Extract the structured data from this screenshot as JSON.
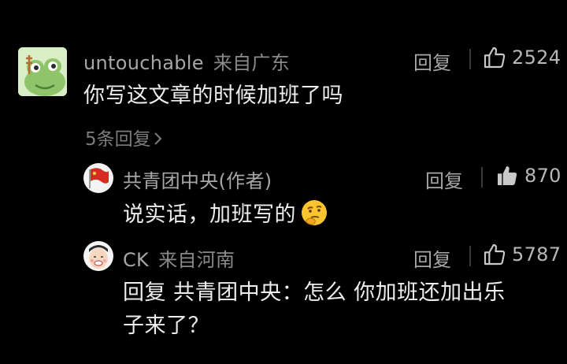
{
  "comment": {
    "username": "untouchable",
    "location": "来自广东",
    "text": "你写这文章的时候加班了吗",
    "reply_label": "回复",
    "likes": "2524",
    "more_replies": "5条回复"
  },
  "replies": [
    {
      "username": "共青团中央(作者)",
      "text": "说实话，加班写的",
      "emoji": "thinking-face",
      "reply_label": "回复",
      "likes": "870",
      "liked": true
    },
    {
      "username": "CK",
      "location": "来自河南",
      "text_line1": "回复 共青团中央：怎么 你加班还加出乐",
      "text_line2": "子来了？",
      "reply_label": "回复",
      "likes": "5787",
      "liked": false
    }
  ],
  "icons": {
    "like": "thumbs-up-outline-icon",
    "liked": "thumbs-up-filled-icon",
    "expand": "chevron-right-icon"
  },
  "colors": {
    "background": "#000000",
    "text": "#ededed",
    "muted": "#a7a7a7",
    "flag_red": "#d62a23"
  }
}
